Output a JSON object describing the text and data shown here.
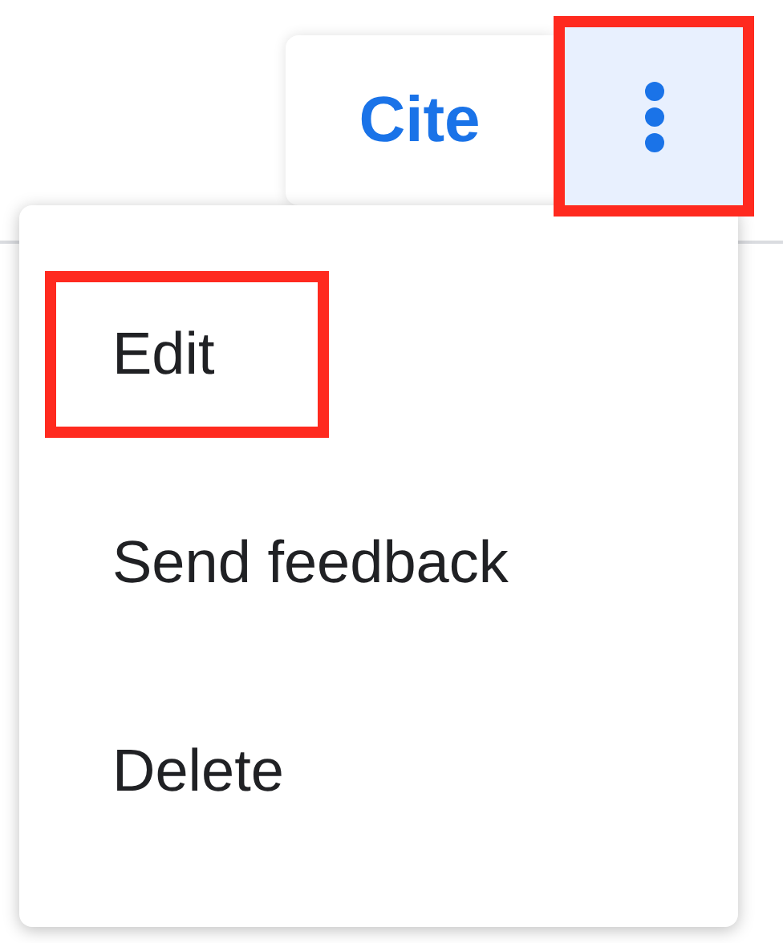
{
  "toolbar": {
    "cite_button": {
      "label": "Cite",
      "highlighted": false
    },
    "more_button": {
      "highlighted": true
    }
  },
  "menu": {
    "items": [
      {
        "label": "Edit",
        "highlighted": true
      },
      {
        "label": "Send feedback",
        "highlighted": false
      },
      {
        "label": "Delete",
        "highlighted": false
      }
    ]
  }
}
